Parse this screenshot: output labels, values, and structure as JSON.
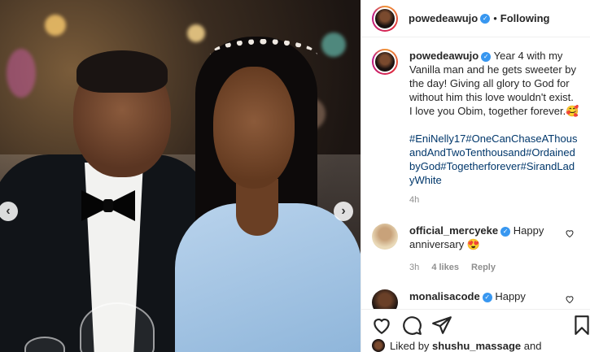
{
  "post": {
    "username": "powedeawujo",
    "follow_status": "Following",
    "separator": "•"
  },
  "caption": {
    "username": "powedeawujo",
    "text": "Year 4 with my Vanilla man and he gets sweeter by the day! Giving all glory to God for without him this love wouldn't exist. I love you Obim, together forever.🥰",
    "hashtags": "#EniNelly17#OneCanChaseAThousandAndTwoTenthousand#OrdainedbyGod#Togetherforever#SirandLadyWhite",
    "time": "4h"
  },
  "comments": [
    {
      "username": "official_mercyeke",
      "text": "Happy anniversary 😍",
      "time": "3h",
      "likes": "4 likes",
      "reply": "Reply"
    },
    {
      "username": "monalisacode",
      "text": "Happy"
    }
  ],
  "likes_line": {
    "prefix": "Liked by",
    "user": "shushu_massage",
    "suffix": "and"
  },
  "icons": {
    "verified": "verified-badge-icon",
    "heart": "heart-icon",
    "comment": "comment-icon",
    "share": "share-icon",
    "save": "bookmark-icon"
  },
  "colors": {
    "link": "#00376b",
    "verified": "#3897f0",
    "muted": "#8e8e8e"
  }
}
